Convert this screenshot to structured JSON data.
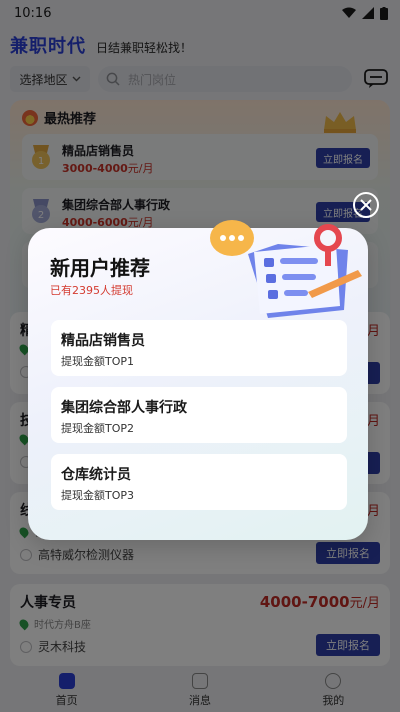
{
  "status": {
    "time": "10:16"
  },
  "header": {
    "brand": "兼职时代",
    "slogan": "日结兼职轻松找！"
  },
  "search": {
    "region": "选择地区",
    "placeholder": "热门岗位"
  },
  "hot": {
    "title": "最热推荐",
    "items": [
      {
        "name": "精品店销售员",
        "salary_range": "3000-4000",
        "salary_unit": "元/月",
        "button": "立即报名",
        "rank": "1"
      },
      {
        "name": "集团综合部人事行政",
        "salary_range": "4000-6000",
        "salary_unit": "元/月",
        "button": "立即报名",
        "rank": "2"
      }
    ]
  },
  "jobs": [
    {
      "title": "精",
      "salary_unit": "月",
      "location": "",
      "company": "",
      "button": ""
    },
    {
      "title": "技",
      "salary_unit": "月",
      "location": "",
      "company": "",
      "button": ""
    },
    {
      "title": "线",
      "salary_unit": "月",
      "location": "鲁",
      "company": "高特威尔检测仪器",
      "button": "立即报名"
    },
    {
      "title": "人事专员",
      "salary_range": "4000-7000",
      "salary_unit": "元/月",
      "location": "时代方舟B座",
      "company": "灵木科技",
      "button": "立即报名"
    }
  ],
  "nav": {
    "home": "首页",
    "messages": "消息",
    "mine": "我的"
  },
  "modal": {
    "title": "新用户推荐",
    "subtitle": "已有2395人提现",
    "items": [
      {
        "title": "精品店销售员",
        "sub": "提现金额TOP1"
      },
      {
        "title": "集团综合部人事行政",
        "sub": "提现金额TOP2"
      },
      {
        "title": "仓库统计员",
        "sub": "提现金额TOP3"
      }
    ]
  },
  "colors": {
    "brand": "#2b3fd6",
    "button": "#2e3fa8",
    "salary": "#c93228",
    "subtitle_red": "#d43b30"
  }
}
